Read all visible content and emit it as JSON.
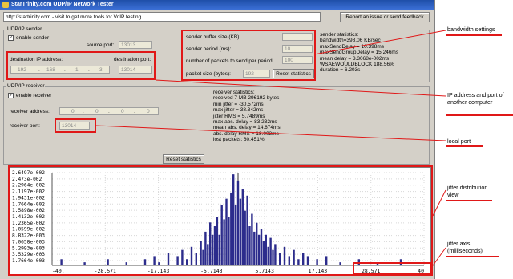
{
  "window": {
    "title": "StarTrinity.com UDP/IP Network Tester"
  },
  "header": {
    "link_text": "http://startrinity.com  - visit to get more tools for VoIP testing",
    "report_button": "Report an issue or send feedback"
  },
  "sender": {
    "group_label": "UDP/IP sender",
    "enable_label": "enable sender",
    "source_port_label": "source port:",
    "source_port": "13013",
    "dest_ip_label": "destination IP address:",
    "dest_port_label": "destination port:",
    "ip_octets": [
      "192",
      "168",
      "1",
      "3"
    ],
    "dest_port": "13014",
    "buffer_label": "sender buffer size (KB):",
    "buffer_value": "",
    "period_label": "sender period (ms):",
    "period_value": "10",
    "packets_label": "number of packets to send per period:",
    "packets_value": "100",
    "packet_size_label": "packet size (bytes):",
    "packet_size_value": "192",
    "reset_button": "Reset statistics",
    "stats": "sender statistics:\nbandwidth=398.06 KB/sec\nmaxSendDelay = 10.398ms\nmaxSendGroupDelay = 15.246ms\nmean delay = 3.3068e-002ms\nWSAEWOULDBLOCK 188.56%\nduration = 6.203s"
  },
  "receiver": {
    "group_label": "UDP/IP receiver",
    "enable_label": "enable receiver",
    "addr_label": "receiver address:",
    "addr_octets": [
      "0",
      "0",
      "0",
      "0"
    ],
    "port_label": "receiver port:",
    "port_value": "13014",
    "reset_button": "Reset statistics",
    "stats": "receiver statistics:\nreceived 7 MB 296192 bytes\nmin jitter = -30.572ms\nmax jitter = 38.342ms\njitter RMS = 5.7489ms\nmax abs. delay = 83.232ms\nmean abs. delay = 14.674ms\nabs. delay RMS = 18.003ms\nlost packets: 60.451%"
  },
  "annotations": {
    "bandwidth": "bandwidth settings",
    "ip_port": "IP address and port of another computer",
    "local_port": "local port",
    "jitter_view": "jitter distribution view",
    "jitter_axis": "jitter axis (milliseconds)"
  },
  "chart_data": {
    "type": "bar",
    "title": "",
    "xlabel": "",
    "ylabel": "",
    "x_ticks": [
      "-40.",
      "-28.571",
      "-17.143",
      "-5.7143",
      "5.7143",
      "17.143",
      "28.571",
      "40"
    ],
    "y_ticks": [
      "2.6497e-002",
      "2.473e-002",
      "2.2964e-002",
      "2.1197e-002",
      "1.9431e-002",
      "1.7664e-002",
      "1.5898e-002",
      "1.4132e-002",
      "1.2365e-002",
      "1.0599e-002",
      "8.8322e-003",
      "7.0658e-003",
      "5.2993e-003",
      "3.5329e-003",
      "1.7664e-003"
    ],
    "xlim": [
      -40,
      40
    ],
    "ylim": [
      0,
      0.027
    ],
    "series": [
      {
        "x": [
          -38,
          -33,
          -28,
          -24,
          -20,
          -18,
          -17,
          -15,
          -13,
          -12,
          -11,
          -10,
          -9,
          -8,
          -7.5,
          -7,
          -6.5,
          -6,
          -5.5,
          -5,
          -4.5,
          -4,
          -3.5,
          -3,
          -2.5,
          -2,
          -1.5,
          -1,
          -0.5,
          0,
          0.5,
          1,
          1.5,
          2,
          2.5,
          3,
          3.5,
          4,
          4.5,
          5,
          5.5,
          6,
          6.5,
          7,
          7.5,
          8,
          9,
          10,
          11,
          12,
          13,
          14,
          15,
          17,
          19,
          22,
          26,
          30,
          35
        ],
        "y": [
          0.0018,
          0.0009,
          0.0018,
          0.0009,
          0.0018,
          0.0027,
          0.0009,
          0.0036,
          0.0027,
          0.0045,
          0.0018,
          0.0054,
          0.0036,
          0.0071,
          0.0045,
          0.0098,
          0.0062,
          0.0125,
          0.0089,
          0.0114,
          0.0141,
          0.0089,
          0.0176,
          0.0134,
          0.0194,
          0.0141,
          0.0212,
          0.0265,
          0.0176,
          0.0247,
          0.0194,
          0.0221,
          0.0159,
          0.0203,
          0.0114,
          0.015,
          0.0098,
          0.0124,
          0.0089,
          0.0106,
          0.0071,
          0.0089,
          0.0054,
          0.008,
          0.0045,
          0.0062,
          0.0036,
          0.0054,
          0.0027,
          0.0045,
          0.0018,
          0.0036,
          0.0027,
          0.0018,
          0.0027,
          0.0009,
          0.0018,
          0.0009,
          0.0018
        ]
      }
    ]
  }
}
